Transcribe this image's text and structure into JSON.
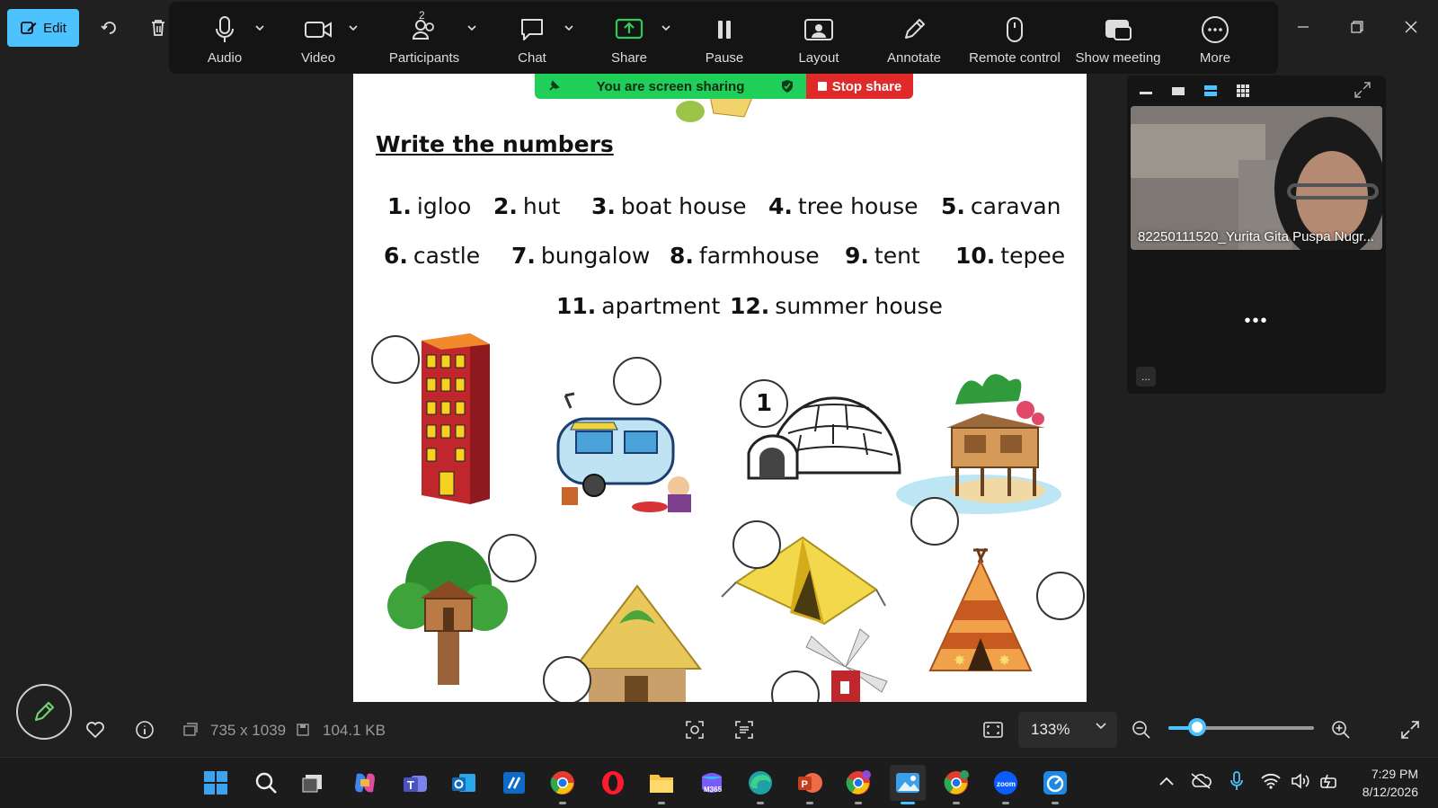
{
  "viewer": {
    "edit_label": "Edit",
    "dimensions": "735 x 1039",
    "file_size": "104.1 KB",
    "zoom_level": "133%",
    "zoom_slider_fraction": 0.2
  },
  "zoom_toolbar": {
    "items": [
      {
        "label": "Audio",
        "icon": "microphone-icon",
        "has_caret": true
      },
      {
        "label": "Video",
        "icon": "video-camera-icon",
        "has_caret": true
      },
      {
        "label": "Participants",
        "icon": "participants-icon",
        "has_caret": true,
        "count": "2"
      },
      {
        "label": "Chat",
        "icon": "chat-bubble-icon",
        "has_caret": true
      },
      {
        "label": "Share",
        "icon": "share-screen-icon",
        "has_caret": true,
        "accent": "#2ecc5a"
      },
      {
        "label": "Pause",
        "icon": "pause-icon",
        "has_caret": false
      },
      {
        "label": "Layout",
        "icon": "layout-icon",
        "has_caret": false
      },
      {
        "label": "Annotate",
        "icon": "pencil-icon",
        "has_caret": false
      },
      {
        "label": "Remote control",
        "icon": "mouse-icon",
        "has_caret": false
      },
      {
        "label": "Show meeting",
        "icon": "show-meeting-icon",
        "has_caret": false
      },
      {
        "label": "More",
        "icon": "more-icon",
        "has_caret": false
      }
    ]
  },
  "share_banner": {
    "status": "You are screen sharing",
    "stop_label": "Stop share",
    "green": "#1fcf5a",
    "red": "#e02a2a"
  },
  "worksheet": {
    "title": "Write the numbers",
    "words": [
      {
        "num": "1.",
        "text": "igloo"
      },
      {
        "num": "2.",
        "text": "hut"
      },
      {
        "num": "3.",
        "text": "boat house"
      },
      {
        "num": "4.",
        "text": "tree house"
      },
      {
        "num": "5.",
        "text": "caravan"
      },
      {
        "num": "6.",
        "text": "castle"
      },
      {
        "num": "7.",
        "text": "bungalow"
      },
      {
        "num": "8.",
        "text": "farmhouse"
      },
      {
        "num": "9.",
        "text": "tent"
      },
      {
        "num": "10.",
        "text": "tepee"
      },
      {
        "num": "11.",
        "text": "apartment"
      },
      {
        "num": "12.",
        "text": "summer house"
      }
    ],
    "answer_filled": "1",
    "pictures": [
      "apartment-building-picture",
      "caravan-picture",
      "igloo-picture",
      "boat-house-picture",
      "tree-house-picture",
      "hut-picture",
      "tent-picture",
      "tepee-picture",
      "windmill-picture"
    ]
  },
  "video_panel": {
    "participant_name": "82250111520_Yurita Gita Puspa Nugr...",
    "more_dots": "•••",
    "small_button": "..."
  },
  "taskbar": {
    "apps": [
      "windows-start-icon",
      "search-icon",
      "task-view-icon",
      "copilot-icon",
      "teams-icon",
      "outlook-icon",
      "vscode-icon",
      "chrome-icon",
      "opera-icon",
      "file-explorer-icon",
      "m365-icon",
      "edge-icon",
      "powerpoint-icon",
      "chrome-profile-icon",
      "photos-icon",
      "chrome-profile-2-icon",
      "zoom-icon",
      "speedtest-icon"
    ],
    "time": "7:29 PM",
    "date": "8/12/2026"
  }
}
